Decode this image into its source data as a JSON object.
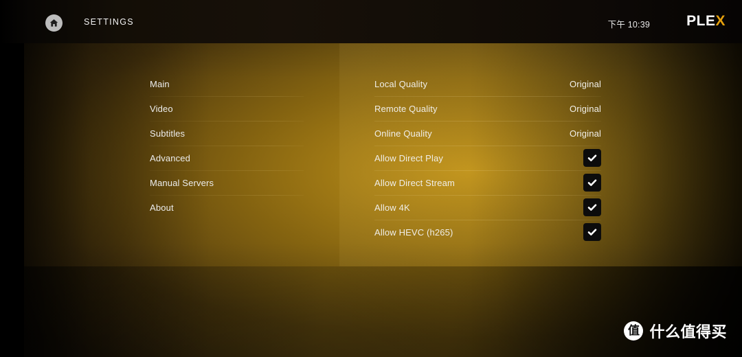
{
  "header": {
    "home_icon": "home-icon",
    "title": "SETTINGS",
    "clock": "下午 10:39",
    "logo_main": "PLE",
    "logo_accent": "X"
  },
  "menu": {
    "items": [
      {
        "label": "Main"
      },
      {
        "label": "Video"
      },
      {
        "label": "Subtitles"
      },
      {
        "label": "Advanced"
      },
      {
        "label": "Manual Servers"
      },
      {
        "label": "About"
      }
    ]
  },
  "settings": {
    "rows": [
      {
        "label": "Local Quality",
        "type": "value",
        "value": "Original"
      },
      {
        "label": "Remote Quality",
        "type": "value",
        "value": "Original"
      },
      {
        "label": "Online Quality",
        "type": "value",
        "value": "Original"
      },
      {
        "label": "Allow Direct Play",
        "type": "checkbox",
        "checked": true
      },
      {
        "label": "Allow Direct Stream",
        "type": "checkbox",
        "checked": true
      },
      {
        "label": "Allow 4K",
        "type": "checkbox",
        "checked": true
      },
      {
        "label": "Allow HEVC (h265)",
        "type": "checkbox",
        "checked": true
      }
    ]
  },
  "watermark": {
    "badge": "值",
    "text": "什么值得买"
  },
  "colors": {
    "accent": "#e5a00d",
    "header_bg": "#120d07",
    "panel_gold": "#6d5413",
    "checkbox_bg": "#0c0c0c",
    "text": "#f0eee8"
  }
}
